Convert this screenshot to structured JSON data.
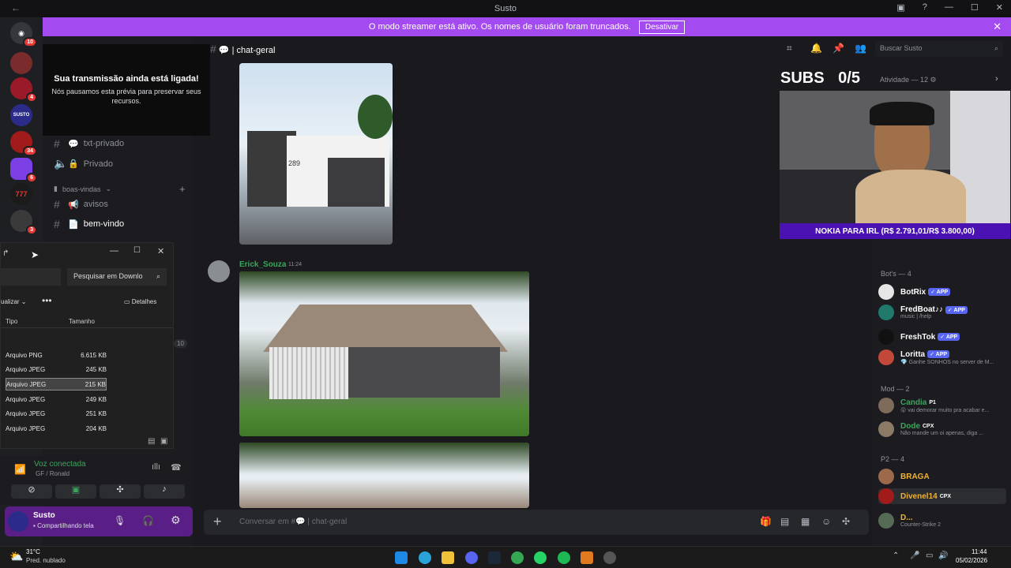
{
  "window": {
    "title": "Susto",
    "controls": [
      "?",
      "—",
      "☐",
      "✕"
    ]
  },
  "banner": {
    "text": "O modo streamer está ativo. Os nomes de usuário foram truncados.",
    "button": "Desativar"
  },
  "servers": [
    {
      "badge": "10",
      "color": "#36373c"
    },
    {
      "badge": "",
      "color": "#7a2b2b"
    },
    {
      "badge": "4",
      "color": "#9b1a2a"
    },
    {
      "badge": "",
      "color": "#2b2b8a",
      "label": "SUSTO"
    },
    {
      "badge": "34",
      "color": "#a11b1b"
    },
    {
      "badge": "6",
      "color": "#7b3fe4"
    },
    {
      "badge": "",
      "color": "#1b1b1b",
      "label": "777"
    },
    {
      "badge": "3",
      "color": "#3a3a3a"
    }
  ],
  "stream_overlay": {
    "title": "Sua transmissão ainda está ligada!",
    "body": "Nós pausamos esta prévia para preservar seus recursos."
  },
  "channels": {
    "items": [
      {
        "name": "txt-privado",
        "emoji": "💬"
      },
      {
        "name": "Privado",
        "emoji": "🔒"
      }
    ],
    "category": "boas-vindas",
    "category_items": [
      {
        "name": "avisos",
        "emoji": "📢"
      },
      {
        "name": "bem-vindo",
        "emoji": "📄"
      }
    ],
    "count_badge": "10"
  },
  "explorer": {
    "search_placeholder": "Pesquisar em Downlo",
    "view_label": "ualizar",
    "details_label": "Detalhes",
    "columns": [
      "Tipo",
      "Tamanho"
    ],
    "rows": [
      {
        "type": "Arquivo PNG",
        "size": "6.615 KB"
      },
      {
        "type": "Arquivo JPEG",
        "size": "245 KB"
      },
      {
        "type": "Arquivo JPEG",
        "size": "215 KB"
      },
      {
        "type": "Arquivo JPEG",
        "size": "249 KB"
      },
      {
        "type": "Arquivo JPEG",
        "size": "251 KB"
      },
      {
        "type": "Arquivo JPEG",
        "size": "204 KB"
      }
    ]
  },
  "voice": {
    "status": "Voz conectada",
    "channel": "GF / Ronald"
  },
  "user": {
    "name": "Susto",
    "status": "Compartilhando tela"
  },
  "header": {
    "channel": "chat-geral",
    "search_placeholder": "Buscar Susto"
  },
  "chat": {
    "author": "Erick_Souza",
    "time": "11:24",
    "house_number": "289"
  },
  "composer": {
    "placeholder": "Conversar em #💬 | chat-geral"
  },
  "subs": {
    "label": "SUBS",
    "value": "0/5"
  },
  "activity": "Atividade — 12",
  "nokia": "NOKIA PARA IRL (R$ 2.791,01/R$ 3.800,00)",
  "members": {
    "bots_header": "Bot's — 4",
    "bots": [
      {
        "name": "BotRix",
        "tag": "✓ APP",
        "sub": "",
        "color": "#e6e6e6"
      },
      {
        "name": "FredBoat♪♪",
        "tag": "✓ APP",
        "sub": "music | /help",
        "color": "#1f7a6b"
      },
      {
        "name": "FreshTok",
        "tag": "✓ APP",
        "sub": "",
        "color": "#111"
      },
      {
        "name": "Loritta",
        "tag": "✓ APP",
        "sub": "💎 Ganhe SONHOS no server de M...",
        "color": "#c2483a"
      }
    ],
    "mod_header": "Mod — 2",
    "mods": [
      {
        "name": "Candia",
        "tag": "P1",
        "sub": "😮 vai demorar muito pra acabar e...",
        "color": "#7e6b5a"
      },
      {
        "name": "Dode",
        "tag": "CPX",
        "sub": "Não mande um oi apenas, diga ...",
        "color": "#8a7a66"
      }
    ],
    "p2_header": "P2 — 4",
    "p2": [
      {
        "name": "BRAGA",
        "tag": "",
        "sub": "",
        "color": "#9c6a4a"
      },
      {
        "name": "Divenel14",
        "tag": "CPX",
        "sub": "",
        "color": "#a11b1b"
      },
      {
        "name": "D...",
        "tag": "",
        "sub": "Counter-Strike 2",
        "color": "#556b55"
      }
    ]
  },
  "taskbar": {
    "weather_temp": "31°C",
    "weather_desc": "Pred. nublado",
    "time": "11:44",
    "date": "05/02/2026"
  }
}
